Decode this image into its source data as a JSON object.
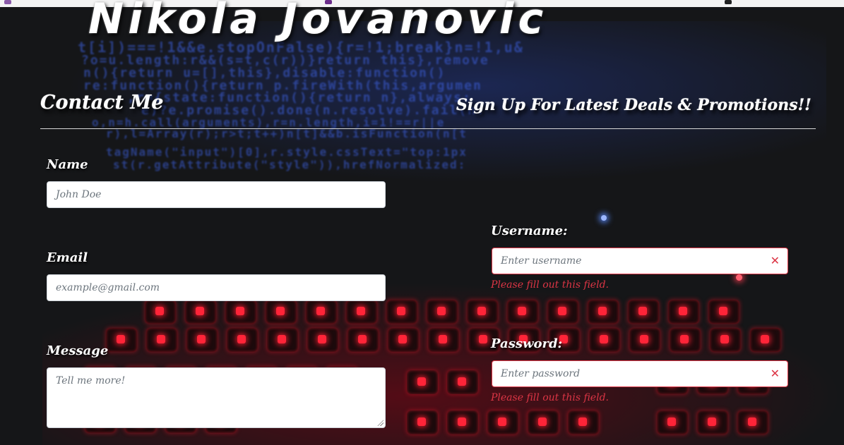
{
  "header": {
    "title": "Nikola Jovanovic"
  },
  "contact": {
    "heading": "Contact Me",
    "name_label": "Name",
    "name_placeholder": "John Doe",
    "email_label": "Email",
    "email_placeholder": "example@gmail.com",
    "message_label": "Message",
    "message_placeholder": "Tell me more!"
  },
  "signup": {
    "heading": "Sign Up For Latest Deals & Promotions!!",
    "username_label": "Username:",
    "username_placeholder": "Enter username",
    "username_error": "Please fill out this field.",
    "password_label": "Password:",
    "password_placeholder": "Enter password",
    "password_error": "Please fill out this field."
  },
  "icons": {
    "invalid": "close-icon",
    "clear_glyph": "✕"
  },
  "colors": {
    "error": "#dc3545",
    "background": "#151618",
    "text": "#ffffff"
  }
}
